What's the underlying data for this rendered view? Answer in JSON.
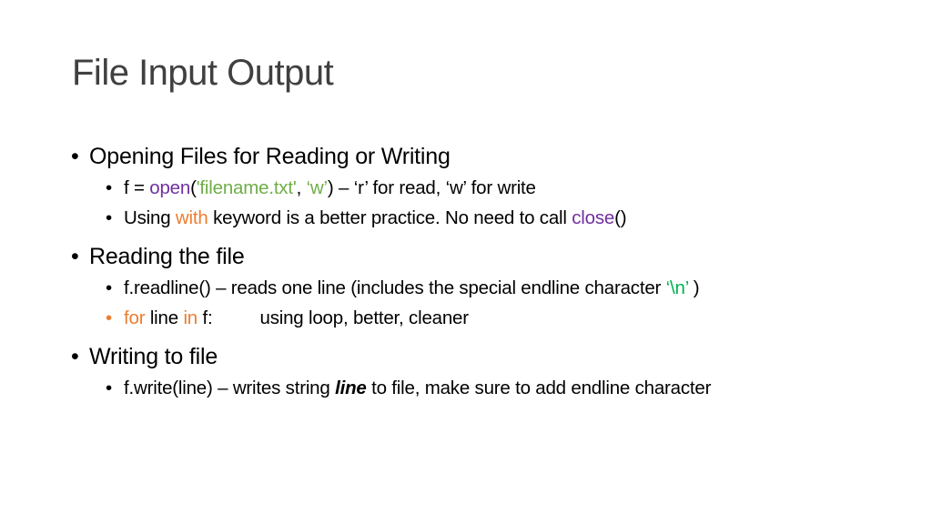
{
  "title": "File Input Output",
  "colors": {
    "purple": "#7030a0",
    "green": "#70ad47",
    "orange": "#ed7d31",
    "teal": "#00b050"
  },
  "sections": [
    {
      "heading": "Opening Files for Reading or Writing",
      "items": [
        {
          "p1": "f = ",
          "open": "open",
          "paren_open": "(",
          "arg1": "'filename.txt'",
          "comma": ", ",
          "arg2": "‘w’",
          "rest": ") – ‘r’ for read, ‘w’ for write"
        },
        {
          "p1": "Using ",
          "with": "with",
          "p2": " keyword is a better practice. No need to call ",
          "close": "close",
          "p3": "()"
        }
      ]
    },
    {
      "heading": "Reading the file",
      "items": [
        {
          "p1": "f.readline() – reads one line (includes the special endline character ",
          "nl": "‘\\n’",
          "p2": " )"
        },
        {
          "for": "for",
          "p1": " line ",
          "in": "in",
          "p2": " f:",
          "desc": "using loop, better, cleaner"
        }
      ]
    },
    {
      "heading": "Writing to file",
      "items": [
        {
          "p1": "f.write(line) – writes string ",
          "em": "line",
          "p2": " to file, make sure to add endline character"
        }
      ]
    }
  ],
  "bullet": "•"
}
